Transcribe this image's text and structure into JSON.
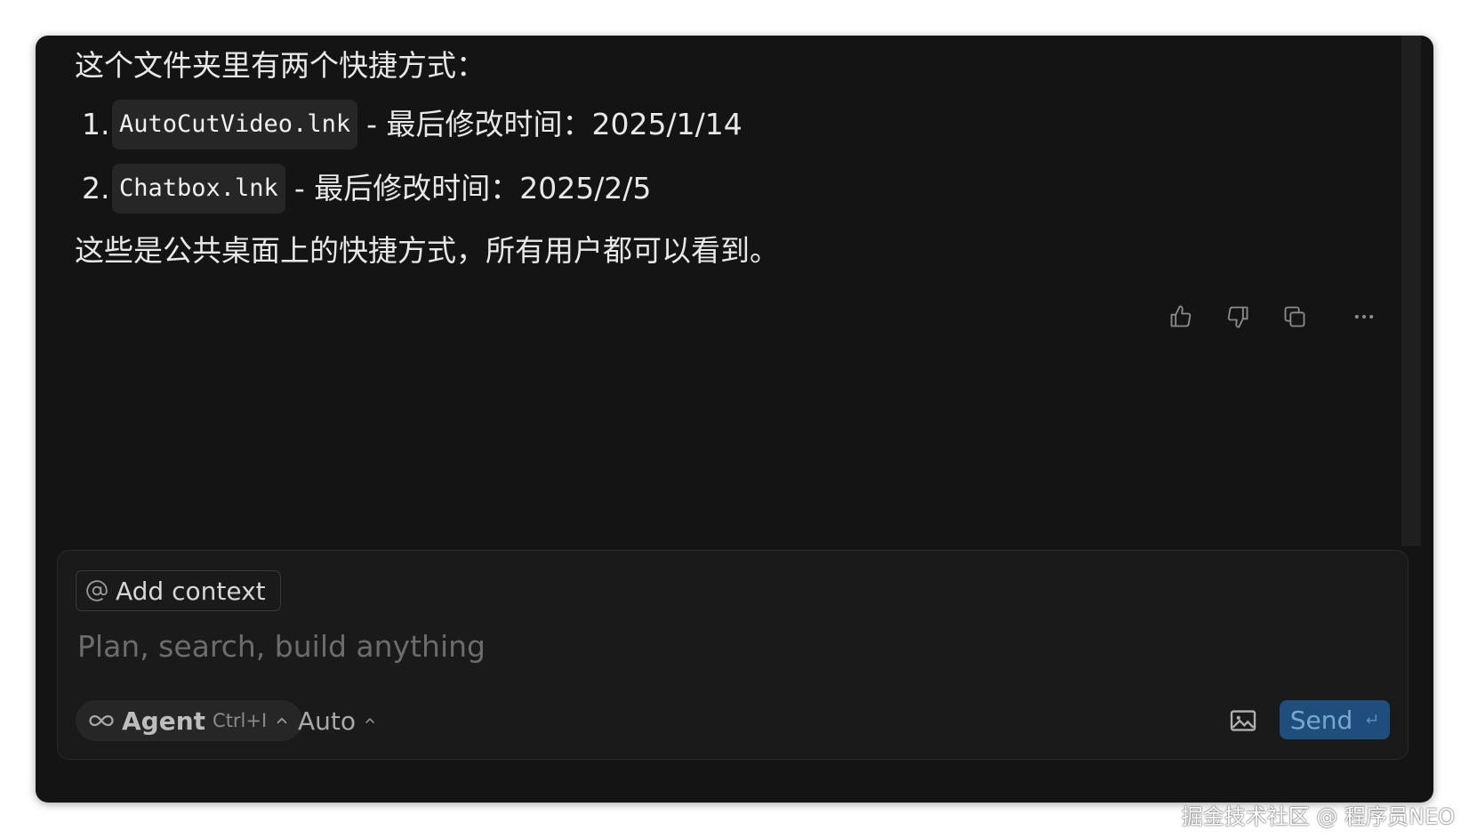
{
  "message": {
    "intro": "这个文件夹里有两个快捷方式：",
    "items": [
      {
        "number": "1.",
        "code": "AutoCutVideo.lnk",
        "text": "- 最后修改时间：2025/1/14"
      },
      {
        "number": "2.",
        "code": "Chatbox.lnk",
        "text": "- 最后修改时间：2025/2/5"
      }
    ],
    "summary": "这些是公共桌面上的快捷方式，所有用户都可以看到。"
  },
  "actions": {
    "icons": [
      "thumbs-up-icon",
      "thumbs-down-icon",
      "copy-icon",
      "more-icon"
    ]
  },
  "composer": {
    "add_context_label": "Add context",
    "placeholder": "Plan, search, build anything",
    "agent_label": "Agent",
    "agent_shortcut": "Ctrl+I",
    "model_label": "Auto",
    "send_label": "Send",
    "send_color": "#1f4e7d"
  },
  "watermark": "掘金技术社区 @ 程序员NEO"
}
